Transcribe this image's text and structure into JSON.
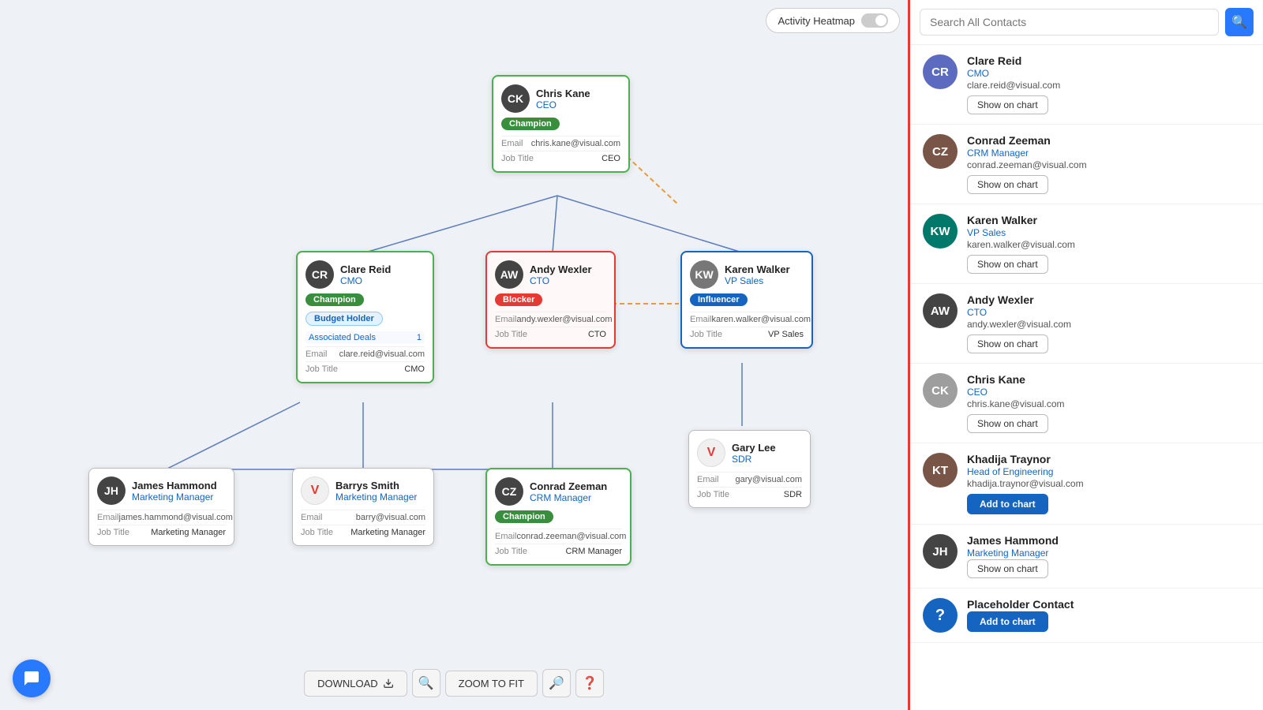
{
  "search": {
    "placeholder": "Search All Contacts"
  },
  "heatmap": {
    "label": "Activity Heatmap"
  },
  "toolbar": {
    "download": "DOWNLOAD",
    "zoom_to_fit": "ZOOM TO FIT"
  },
  "contacts_sidebar": [
    {
      "name": "Clare Reid",
      "role": "CMO",
      "email": "clare.reid@visual.com",
      "action": "show",
      "avatar_color": "blue",
      "initials": "CR"
    },
    {
      "name": "Conrad Zeeman",
      "role": "CRM Manager",
      "email": "conrad.zeeman@visual.com",
      "action": "show",
      "avatar_color": "brown",
      "initials": "CZ"
    },
    {
      "name": "Karen Walker",
      "role": "VP Sales",
      "email": "karen.walker@visual.com",
      "action": "show",
      "avatar_color": "teal",
      "initials": "KW"
    },
    {
      "name": "Andy Wexler",
      "role": "CTO",
      "email": "andy.wexler@visual.com",
      "action": "show",
      "avatar_color": "dark",
      "initials": "AW"
    },
    {
      "name": "Chris Kane",
      "role": "CEO",
      "email": "chris.kane@visual.com",
      "action": "show",
      "avatar_color": "gray",
      "initials": "CK"
    },
    {
      "name": "Khadija Traynor",
      "role": "Head of Engineering",
      "email": "khadija.traynor@visual.com",
      "action": "add",
      "avatar_color": "brown",
      "initials": "KT"
    },
    {
      "name": "James Hammond",
      "role": "Marketing Manager",
      "email": "",
      "action": "show",
      "avatar_color": "dark",
      "initials": "JH"
    },
    {
      "name": "Placeholder Contact",
      "role": "",
      "email": "",
      "action": "add",
      "avatar_color": "placeholder",
      "initials": "?"
    }
  ],
  "buttons": {
    "show_on_chart": "Show on chart",
    "add_to_chart": "Add to chart"
  },
  "cards": {
    "chris_kane": {
      "name": "Chris Kane",
      "role": "CEO",
      "badge": "Champion",
      "email_label": "Email",
      "email_value": "chris.kane@visual.com",
      "job_label": "Job Title",
      "job_value": "CEO"
    },
    "clare_reid": {
      "name": "Clare Reid",
      "role": "CMO",
      "badge1": "Champion",
      "badge2": "Budget Holder",
      "deals_label": "Associated Deals",
      "deals_value": "1",
      "email_label": "Email",
      "email_value": "clare.reid@visual.com",
      "job_label": "Job Title",
      "job_value": "CMO"
    },
    "andy_wexler": {
      "name": "Andy Wexler",
      "role": "CTO",
      "badge": "Blocker",
      "email_label": "Email",
      "email_value": "andy.wexler@visual.com",
      "job_label": "Job Title",
      "job_value": "CTO"
    },
    "karen_walker": {
      "name": "Karen Walker",
      "role": "VP Sales",
      "badge": "Influencer",
      "email_label": "Email",
      "email_value": "karen.walker@visual.com",
      "job_label": "Job Title",
      "job_value": "VP Sales"
    },
    "james_hammond": {
      "name": "James Hammond",
      "role": "Marketing Manager",
      "email_label": "Email",
      "email_value": "james.hammond@visual.com",
      "job_label": "Job Title",
      "job_value": "Marketing Manager"
    },
    "barrys_smith": {
      "name": "Barrys Smith",
      "role": "Marketing Manager",
      "email_label": "Email",
      "email_value": "barry@visual.com",
      "job_label": "Job Title",
      "job_value": "Marketing Manager"
    },
    "conrad_zeeman": {
      "name": "Conrad Zeeman",
      "role": "CRM Manager",
      "badge": "Champion",
      "email_label": "Email",
      "email_value": "conrad.zeeman@visual.com",
      "job_label": "Job Title",
      "job_value": "CRM Manager"
    },
    "gary_lee": {
      "name": "Gary Lee",
      "role": "SDR",
      "email_label": "Email",
      "email_value": "gary@visual.com",
      "job_label": "Job Title",
      "job_value": "SDR"
    }
  }
}
